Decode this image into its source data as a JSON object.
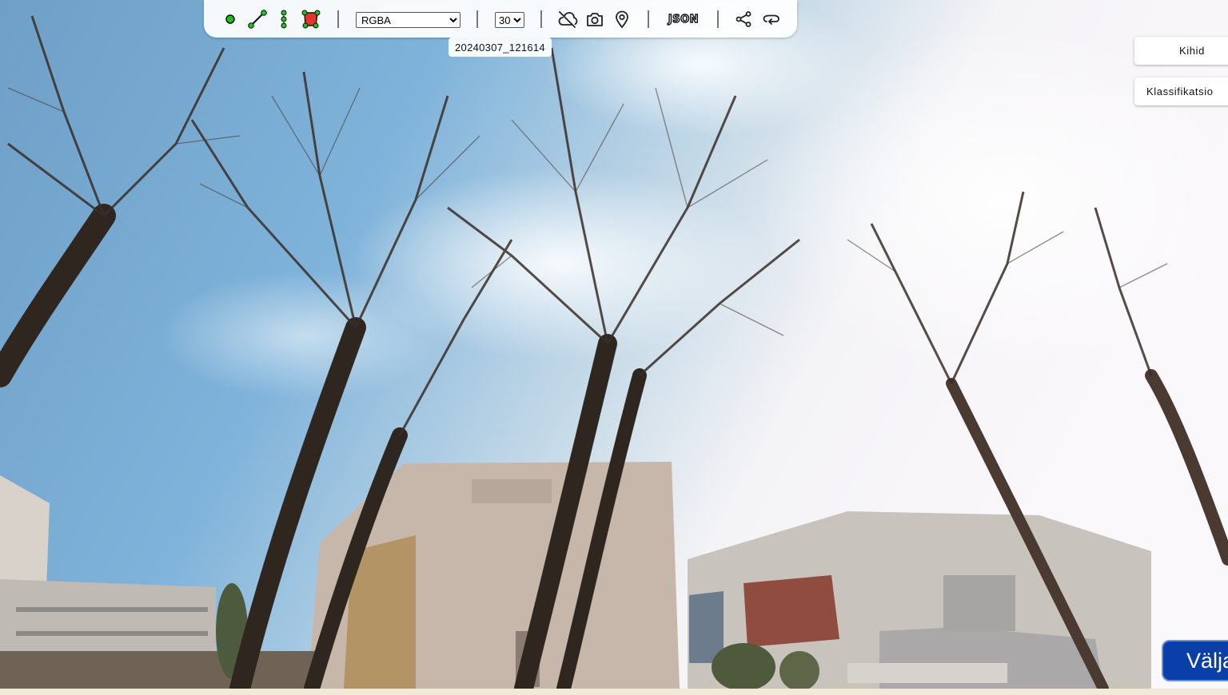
{
  "toolbar": {
    "tools": [
      "point-tool",
      "line-tool",
      "vertical-line-tool",
      "polygon-tool"
    ],
    "image_mode": {
      "selected": "RGBA",
      "options": [
        "RGBA"
      ]
    },
    "frame_rate": {
      "selected": "30",
      "options": [
        "30"
      ]
    },
    "json_label": "JSON",
    "actions": [
      "hide-layer",
      "camera",
      "location-pin",
      "share",
      "undo"
    ]
  },
  "image": {
    "capture_id": "20240307_121614"
  },
  "side_panel": {
    "layers_label": "Kihid",
    "classification_label": "Klassifikatsio"
  },
  "footer": {
    "select_label": "Välja"
  },
  "colors": {
    "tool_green": "#19c319",
    "polygon_red": "#e53527",
    "select_button": "#0a3ea8"
  }
}
